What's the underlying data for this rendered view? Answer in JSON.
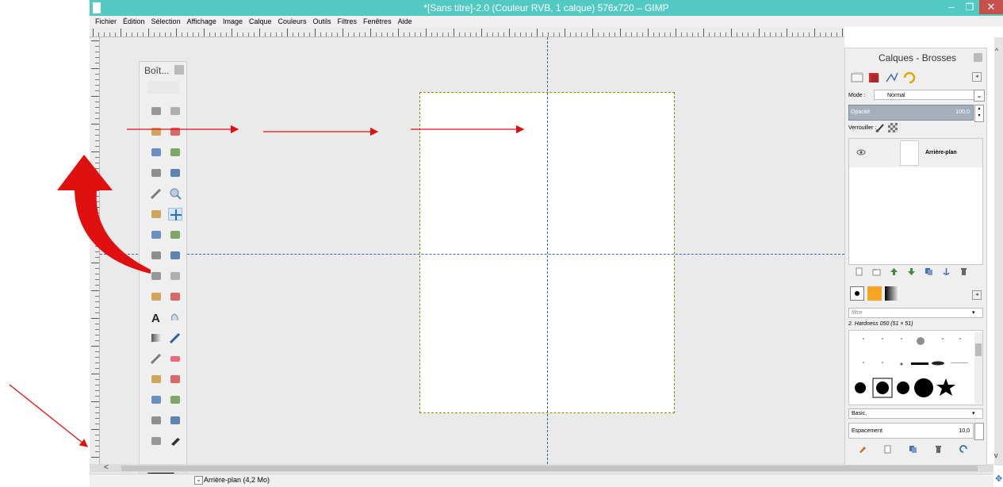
{
  "window": {
    "title": "*[Sans titre]-2.0 (Couleur RVB, 1 calque) 576x720 – GIMP",
    "minimize_icon": "minimize-icon",
    "maximize_icon": "maximize-icon",
    "close_icon": "close-icon",
    "minimize_glyph": "–",
    "maximize_glyph": "❐",
    "close_glyph": "✕"
  },
  "menu": {
    "items": [
      "Fichier",
      "Édition",
      "Sélection",
      "Affichage",
      "Image",
      "Calque",
      "Couleurs",
      "Outils",
      "Filtres",
      "Fenêtres",
      "Aide"
    ]
  },
  "toolbox": {
    "title": "Boît...",
    "tools": [
      "rect-select",
      "ellipse-select",
      "lasso",
      "fuzzy-select",
      "color-select",
      "scissors",
      "foreground-select",
      "paths",
      "color-picker",
      "zoom",
      "measure",
      "move",
      "align",
      "crop",
      "rotate",
      "scale",
      "shear",
      "perspective",
      "flip",
      "cage",
      "text",
      "heal",
      "blend",
      "pencil",
      "paintbrush",
      "eraser",
      "airbrush",
      "ink",
      "clone",
      "perspective-clone",
      "smudge",
      "blur",
      "dodge",
      "smudge-2"
    ],
    "fg_color": "#000000",
    "bg_color": "#ffffff"
  },
  "canvas": {
    "background": "#eaeaea",
    "guide_color": "#3366aa",
    "selection_color": "#8a8a00"
  },
  "status": {
    "layer_info": "Arrière-plan (4,2 Mo)",
    "scroll_left": "<",
    "scroll_up": "^",
    "scroll_down": "v",
    "nav_glyph": "✥"
  },
  "dock": {
    "title": "Calques - Brosses",
    "tab_menu_glyph": "◂",
    "mode_label": "Mode :",
    "mode_value": "Normal",
    "mode_arrow": "⌄",
    "opacity_label": "Opacité",
    "opacity_value": "100,0",
    "lock_label": "Verrouiller :",
    "layers": [
      {
        "name": "Arrière-plan",
        "visible": true
      }
    ],
    "filter_placeholder": "filtre",
    "filter_arrow": "▾",
    "brush_name": "2. Hardness 050 (51 × 51)",
    "preset_value": "Basic,",
    "preset_arrow": "▾",
    "spacing_label": "Espacement",
    "spacing_value": "10,0"
  },
  "annotations": {
    "red_arrow_color": "#e01010"
  }
}
